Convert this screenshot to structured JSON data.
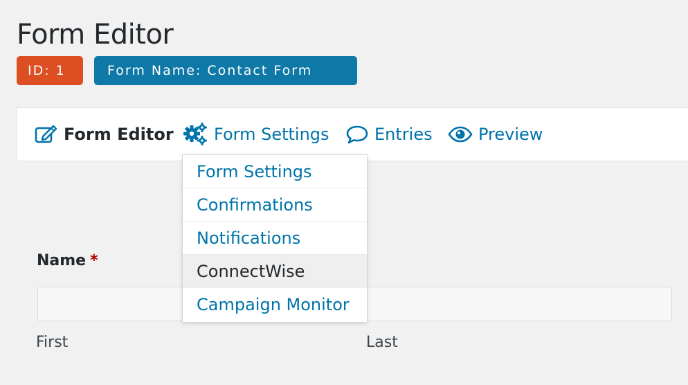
{
  "header": {
    "title": "Form Editor",
    "id_badge": "ID: 1",
    "name_badge": "Form Name: Contact Form"
  },
  "toolbar": {
    "items": [
      {
        "label": "Form Editor",
        "icon": "edit-icon"
      },
      {
        "label": "Form Settings",
        "icon": "gears-icon"
      },
      {
        "label": "Entries",
        "icon": "speech-bubble-icon"
      },
      {
        "label": "Preview",
        "icon": "eye-icon"
      }
    ]
  },
  "settings_menu": {
    "items": [
      {
        "label": "Form Settings"
      },
      {
        "label": "Confirmations"
      },
      {
        "label": "Notifications"
      },
      {
        "label": "ConnectWise",
        "hovered": true
      },
      {
        "label": "Campaign Monitor"
      }
    ]
  },
  "form": {
    "name_field": {
      "label": "Name",
      "required_marker": "*",
      "value": "",
      "first_label": "First",
      "last_label": "Last"
    }
  },
  "colors": {
    "id_badge": "#dd4f23",
    "name_badge": "#0e78a7",
    "link": "#0073aa",
    "required": "#aa0000"
  }
}
